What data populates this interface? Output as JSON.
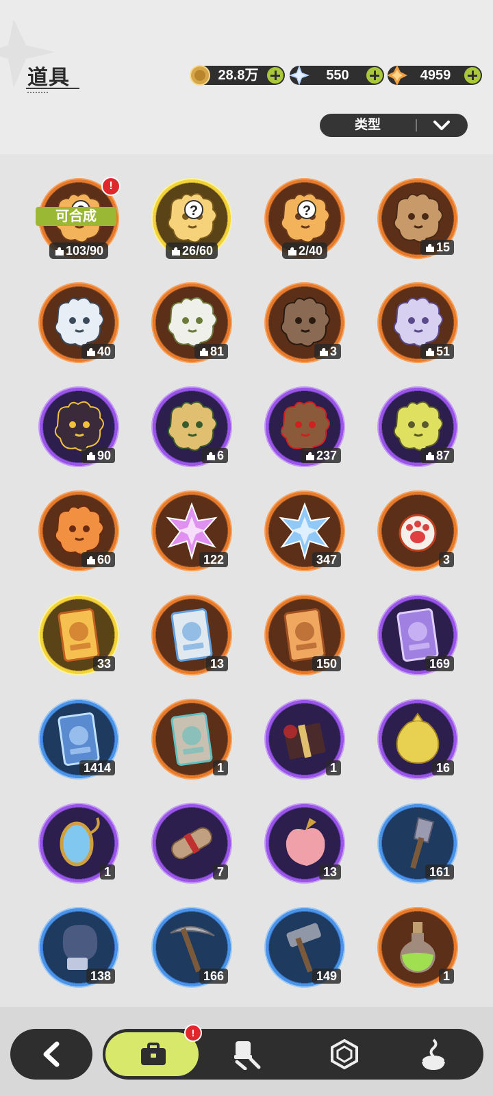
{
  "header": {
    "title": "道具",
    "currencies": [
      {
        "name": "coin-icon",
        "value": "28.8万",
        "color": "#d7a64a"
      },
      {
        "name": "crystal-icon",
        "value": "550",
        "color": "#b8d8ff"
      },
      {
        "name": "star-gem-icon",
        "value": "4959",
        "color": "#f2a142"
      }
    ],
    "filter_label": "类型"
  },
  "items": [
    {
      "ring": "orange",
      "art": "puzzle-orange-icon",
      "synth": "可合成",
      "alert": "!",
      "count_have": "103",
      "count_need": "/90",
      "count_type": "ratio-green"
    },
    {
      "ring": "gold",
      "art": "puzzle-gold-icon",
      "count_have": "26",
      "count_need": "/60",
      "count_type": "ratio-red"
    },
    {
      "ring": "orange",
      "art": "puzzle-orange-icon",
      "count_have": "2",
      "count_need": "/40",
      "count_type": "ratio-red"
    },
    {
      "ring": "orange",
      "art": "bear-piece-icon",
      "count": "15",
      "piece": true
    },
    {
      "ring": "orange",
      "art": "white-cat-piece-icon",
      "count": "40",
      "piece": true
    },
    {
      "ring": "orange",
      "art": "green-eye-cat-piece-icon",
      "count": "81",
      "piece": true
    },
    {
      "ring": "orange",
      "art": "brown-bear-piece-icon",
      "count": "3",
      "piece": true
    },
    {
      "ring": "orange",
      "art": "purple-cat-piece-icon",
      "count": "51",
      "piece": true
    },
    {
      "ring": "purple",
      "art": "black-cat-piece-icon",
      "count": "90",
      "piece": true
    },
    {
      "ring": "purple",
      "art": "leaf-cat-piece-icon",
      "count": "6",
      "piece": true
    },
    {
      "ring": "purple",
      "art": "red-eye-bear-piece-icon",
      "count": "237",
      "piece": true
    },
    {
      "ring": "purple",
      "art": "yellow-cat-piece-icon",
      "count": "87",
      "piece": true
    },
    {
      "ring": "orange",
      "art": "tiger-piece-icon",
      "count": "60",
      "piece": true
    },
    {
      "ring": "orange",
      "art": "pink-crystal-icon",
      "count": "122"
    },
    {
      "ring": "orange",
      "art": "blue-crystal-icon",
      "count": "347"
    },
    {
      "ring": "orange",
      "art": "paw-ornament-icon",
      "count": "3"
    },
    {
      "ring": "gold",
      "art": "gold-card-icon",
      "count": "33"
    },
    {
      "ring": "orange",
      "art": "holo-card-icon",
      "count": "13"
    },
    {
      "ring": "orange",
      "art": "orange-card-icon",
      "count": "150"
    },
    {
      "ring": "purple",
      "art": "purple-card-icon",
      "count": "169"
    },
    {
      "ring": "blue",
      "art": "blue-card-icon",
      "count": "1414"
    },
    {
      "ring": "orange",
      "art": "silver-card-icon",
      "count": "1"
    },
    {
      "ring": "purple",
      "art": "gift-box-icon",
      "count": "1"
    },
    {
      "ring": "purple",
      "art": "gold-sack-icon",
      "count": "16"
    },
    {
      "ring": "purple",
      "art": "magic-mirror-icon",
      "count": "1"
    },
    {
      "ring": "purple",
      "art": "scroll-icon",
      "count": "7"
    },
    {
      "ring": "purple",
      "art": "pink-apple-icon",
      "count": "13"
    },
    {
      "ring": "blue",
      "art": "shovel-icon",
      "count": "161"
    },
    {
      "ring": "blue",
      "art": "glove-icon",
      "count": "138"
    },
    {
      "ring": "blue",
      "art": "pickaxe-icon",
      "count": "166"
    },
    {
      "ring": "blue",
      "art": "hammer-icon",
      "count": "149"
    },
    {
      "ring": "orange",
      "art": "potion-icon",
      "count": "1"
    }
  ],
  "nav": {
    "back": "back-arrow-icon",
    "tabs": [
      {
        "name": "bag-icon",
        "active": true,
        "alert": "!"
      },
      {
        "name": "chef-icon"
      },
      {
        "name": "hexagon-icon"
      },
      {
        "name": "coffee-icon"
      }
    ]
  }
}
